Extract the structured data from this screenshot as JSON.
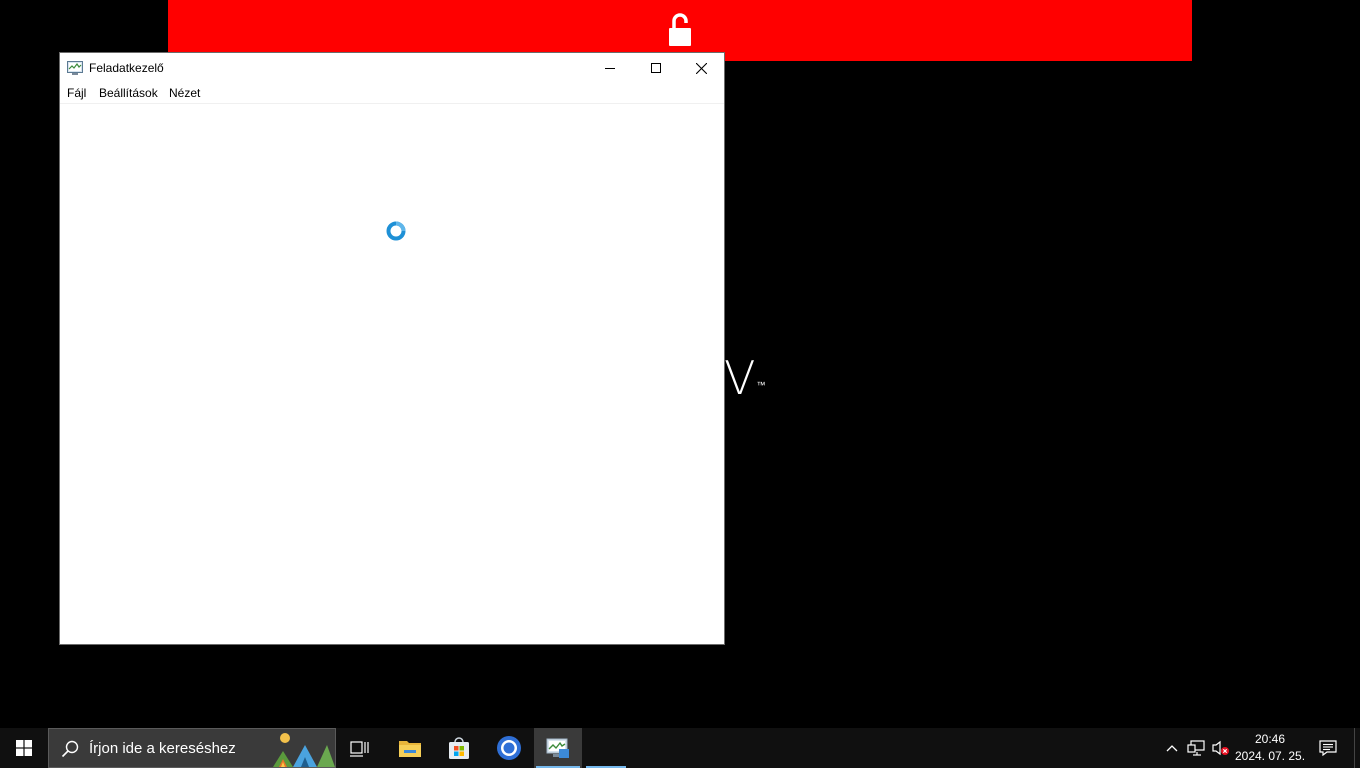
{
  "desktop": {
    "brand_text": "V",
    "brand_mark": "™"
  },
  "window": {
    "title": "Feladatkezelő",
    "menu": [
      "Fájl",
      "Beállítások",
      "Nézet"
    ]
  },
  "taskbar": {
    "search_placeholder": "Írjon ide a kereséshez",
    "time": "20:46",
    "date": "2024. 07. 25."
  },
  "colors": {
    "red_banner": "#ff0000",
    "accent": "#76b9ed",
    "spinner": "#1e90d6"
  }
}
